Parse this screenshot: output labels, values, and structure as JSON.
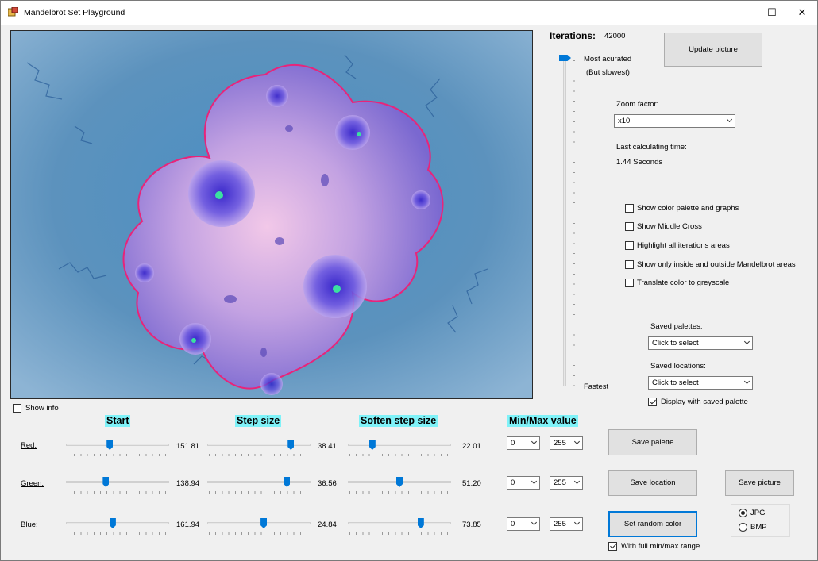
{
  "window": {
    "title": "Mandelbrot Set Playground",
    "minimize": "—",
    "maximize": "☐",
    "close": "✕"
  },
  "iterations": {
    "label": "Iterations:",
    "value": "42000",
    "top_label": "Most acurated",
    "top_sub": "(But slowest)",
    "bottom_label": "Fastest",
    "level": 0.0
  },
  "update_button": "Update picture",
  "zoom": {
    "label": "Zoom factor:",
    "value": "x10"
  },
  "calc_time": {
    "label": "Last calculating time:",
    "value": "1.44 Seconds"
  },
  "options": [
    {
      "label": "Show color palette and graphs",
      "checked": false
    },
    {
      "label": "Show Middle Cross",
      "checked": false
    },
    {
      "label": "Highlight all iterations areas",
      "checked": false
    },
    {
      "label": "Show only inside and outside Mandelbrot areas",
      "checked": false
    },
    {
      "label": "Translate color to greyscale",
      "checked": false
    }
  ],
  "saved_palettes": {
    "label": "Saved palettes:",
    "value": "Click to select"
  },
  "saved_locations": {
    "label": "Saved locations:",
    "value": "Click to select"
  },
  "display_saved_palette": {
    "label": "Display with saved palette",
    "checked": true
  },
  "show_info": {
    "label": "Show info",
    "checked": false
  },
  "headers": {
    "start": "Start",
    "step": "Step size",
    "soften": "Soften step size",
    "minmax": "Min/Max value"
  },
  "rows": [
    {
      "label": "Red:",
      "start": "151.81",
      "start_pos": 0.42,
      "step": "38.41",
      "step_pos": 0.83,
      "soften": "22.01",
      "soften_pos": 0.22,
      "min": "0",
      "max": "255"
    },
    {
      "label": "Green:",
      "start": "138.94",
      "start_pos": 0.38,
      "step": "36.56",
      "step_pos": 0.79,
      "soften": "51.20",
      "soften_pos": 0.5,
      "min": "0",
      "max": "255"
    },
    {
      "label": "Blue:",
      "start": "161.94",
      "start_pos": 0.45,
      "step": "24.84",
      "step_pos": 0.55,
      "soften": "73.85",
      "soften_pos": 0.72,
      "min": "0",
      "max": "255"
    }
  ],
  "buttons": {
    "save_palette": "Save  palette",
    "save_location": "Save location",
    "save_picture": "Save picture",
    "random_color": "Set random color"
  },
  "full_range": {
    "label": "With full min/max range",
    "checked": true
  },
  "format": {
    "jpg": "JPG",
    "bmp": "BMP",
    "selected": "JPG"
  }
}
